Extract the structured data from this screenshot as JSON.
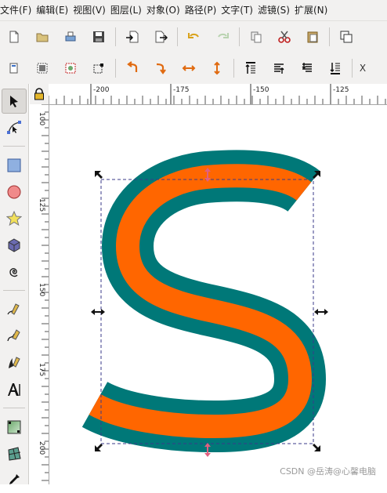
{
  "menubar": {
    "items": [
      "文件(F)",
      "编辑(E)",
      "视图(V)",
      "图层(L)",
      "对象(O)",
      "路径(P)",
      "文字(T)",
      "滤镜(S)",
      "扩展(N)"
    ]
  },
  "toolbar2": {
    "overflow_label": "X"
  },
  "ruler": {
    "h_labels": [
      "-200",
      "-175",
      "-150",
      "-125"
    ],
    "v_labels": [
      "100",
      "125",
      "150",
      "175",
      "200"
    ]
  },
  "canvas": {
    "letter": "S",
    "fill_color": "#ff6600",
    "stroke_color": "#007878",
    "selection_color": "#3a3a8a"
  },
  "watermark": "CSDN @岳涛@心馨电脑"
}
